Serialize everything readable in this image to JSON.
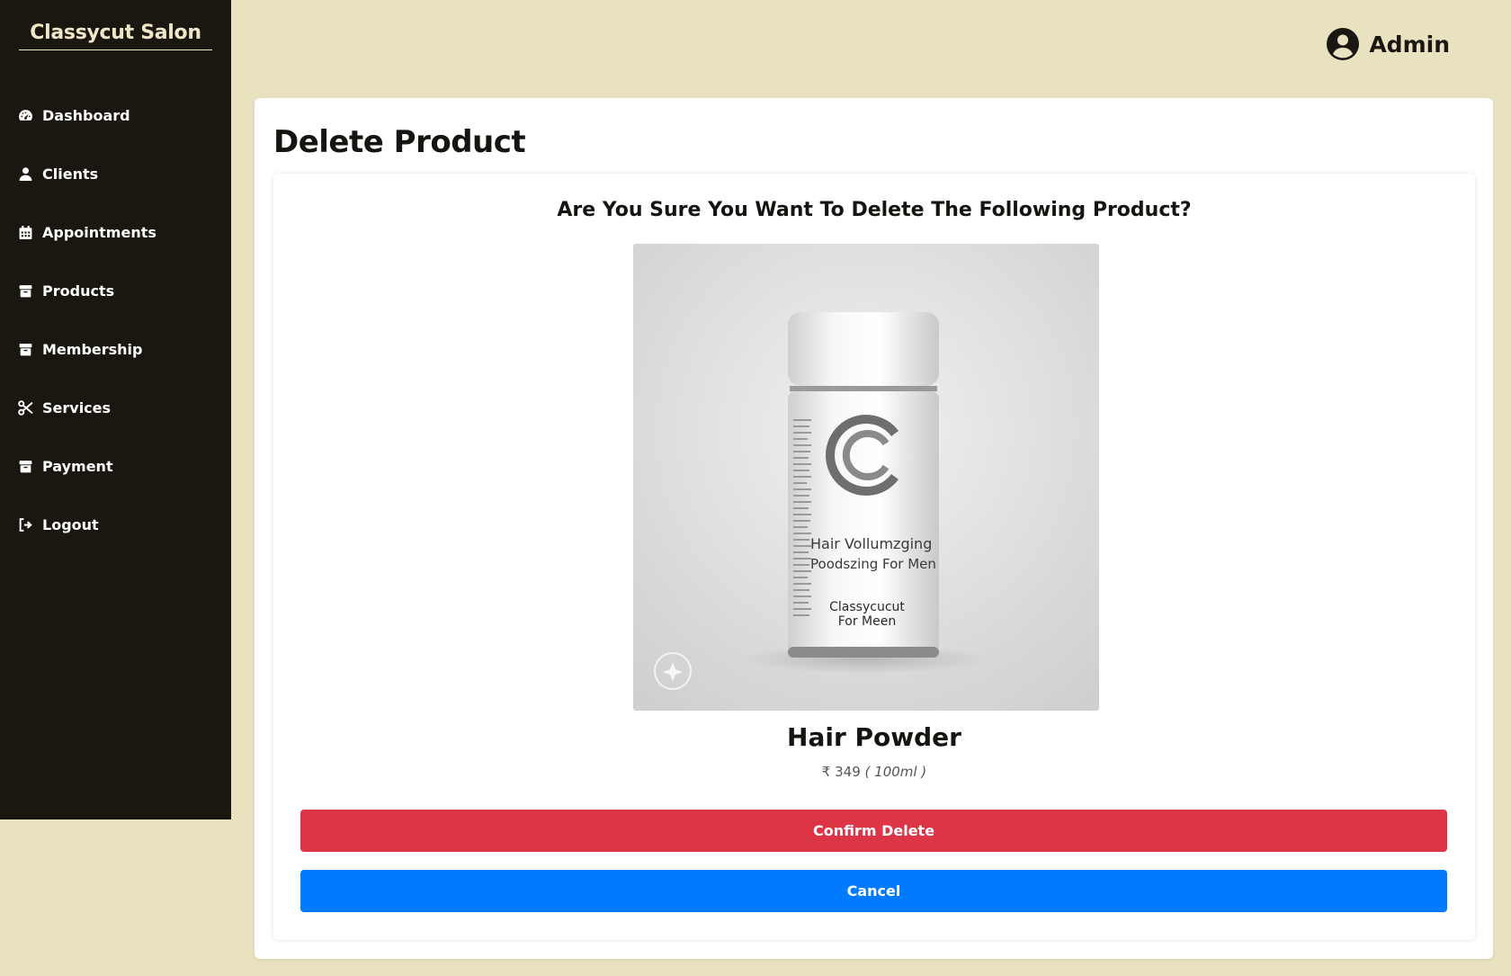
{
  "sidebar": {
    "brand": "Classycut Salon",
    "items": [
      {
        "label": "Dashboard",
        "icon": "gauge-icon"
      },
      {
        "label": "Clients",
        "icon": "user-icon"
      },
      {
        "label": "Appointments",
        "icon": "calendar-icon"
      },
      {
        "label": "Products",
        "icon": "box-icon"
      },
      {
        "label": "Membership",
        "icon": "box-icon"
      },
      {
        "label": "Services",
        "icon": "scissors-icon"
      },
      {
        "label": "Payment",
        "icon": "box-icon"
      },
      {
        "label": "Logout",
        "icon": "logout-icon"
      }
    ]
  },
  "header": {
    "user": "Admin",
    "user_icon": "user-circle-icon"
  },
  "main": {
    "title": "Delete Product",
    "question": "Are You Sure You Want To Delete The Following Product?",
    "product": {
      "name": "Hair Powder",
      "price": "₹ 349",
      "quantity": "( 100ml )",
      "image_alt": "product image",
      "image_text": {
        "line1": "Hair Vollumzging",
        "line2": "Poodszing For Men",
        "brand1": "Classycucut",
        "brand2": "For Meen"
      }
    },
    "confirm_label": "Confirm Delete",
    "cancel_label": "Cancel"
  },
  "colors": {
    "background": "#e8e2c1",
    "sidebar": "#1a1610",
    "danger": "#dc3545",
    "primary": "#007bff"
  }
}
